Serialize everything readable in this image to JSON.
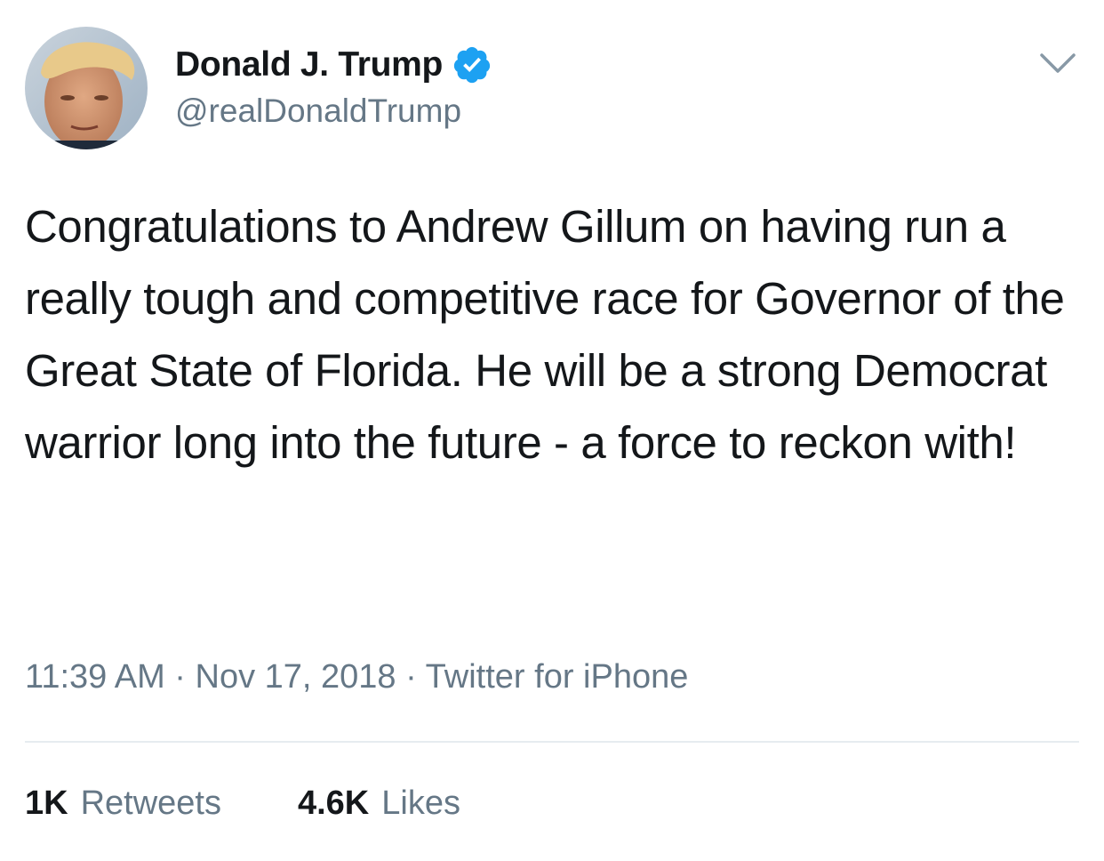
{
  "author": {
    "display_name": "Donald J. Trump",
    "handle": "@realDonaldTrump",
    "verified": true
  },
  "tweet": {
    "text": "Congratulations to Andrew Gillum on having run a really tough and competitive race for Governor of the Great State of Florida. He will be a strong Democrat warrior long into the future - a force to reckon with!",
    "time": "11:39 AM",
    "separator": "·",
    "date": "Nov 17, 2018",
    "source": "Twitter for iPhone"
  },
  "stats": {
    "retweets_count": "1K",
    "retweets_label": "Retweets",
    "likes_count": "4.6K",
    "likes_label": "Likes"
  },
  "colors": {
    "text_primary": "#14171a",
    "text_secondary": "#657786",
    "verified_blue": "#1da1f2",
    "divider": "#e6ecf0"
  },
  "icons": {
    "verified": "verified-badge-icon",
    "menu": "chevron-down-icon"
  }
}
